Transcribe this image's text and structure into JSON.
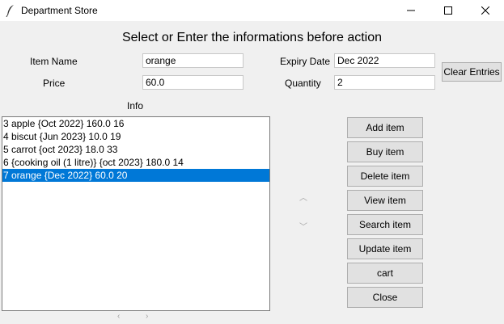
{
  "window": {
    "title": "Department Store",
    "controls": {
      "minimize": "–",
      "maximize": "☐",
      "close": "✕"
    }
  },
  "heading": "Select or Enter the informations before action",
  "form": {
    "item_name_label": "Item Name",
    "item_name_value": "orange",
    "price_label": "Price",
    "price_value": "60.0",
    "expiry_label": "Expiry Date",
    "expiry_value": "Dec 2022",
    "quantity_label": "Quantity",
    "quantity_value": "2",
    "clear_button": "Clear Entries"
  },
  "info_label": "Info",
  "list": {
    "items": [
      "3 apple {Oct 2022} 160.0 16",
      "4 biscut {Jun 2023} 10.0 19",
      "5 carrot {oct 2023} 18.0 33",
      "6 {cooking oil (1 litre)} {oct 2023} 180.0 14",
      "7 orange {Dec 2022} 60.0 20"
    ],
    "selected_index": 4
  },
  "buttons": {
    "add": "Add item",
    "buy": "Buy item",
    "delete": "Delete item",
    "view": "View item",
    "search": "Search item",
    "update": "Update item",
    "cart": "cart",
    "close": "Close"
  },
  "colors": {
    "selection": "#0078d7",
    "window_bg": "#f0f0f0",
    "button_bg": "#e1e1e1"
  }
}
